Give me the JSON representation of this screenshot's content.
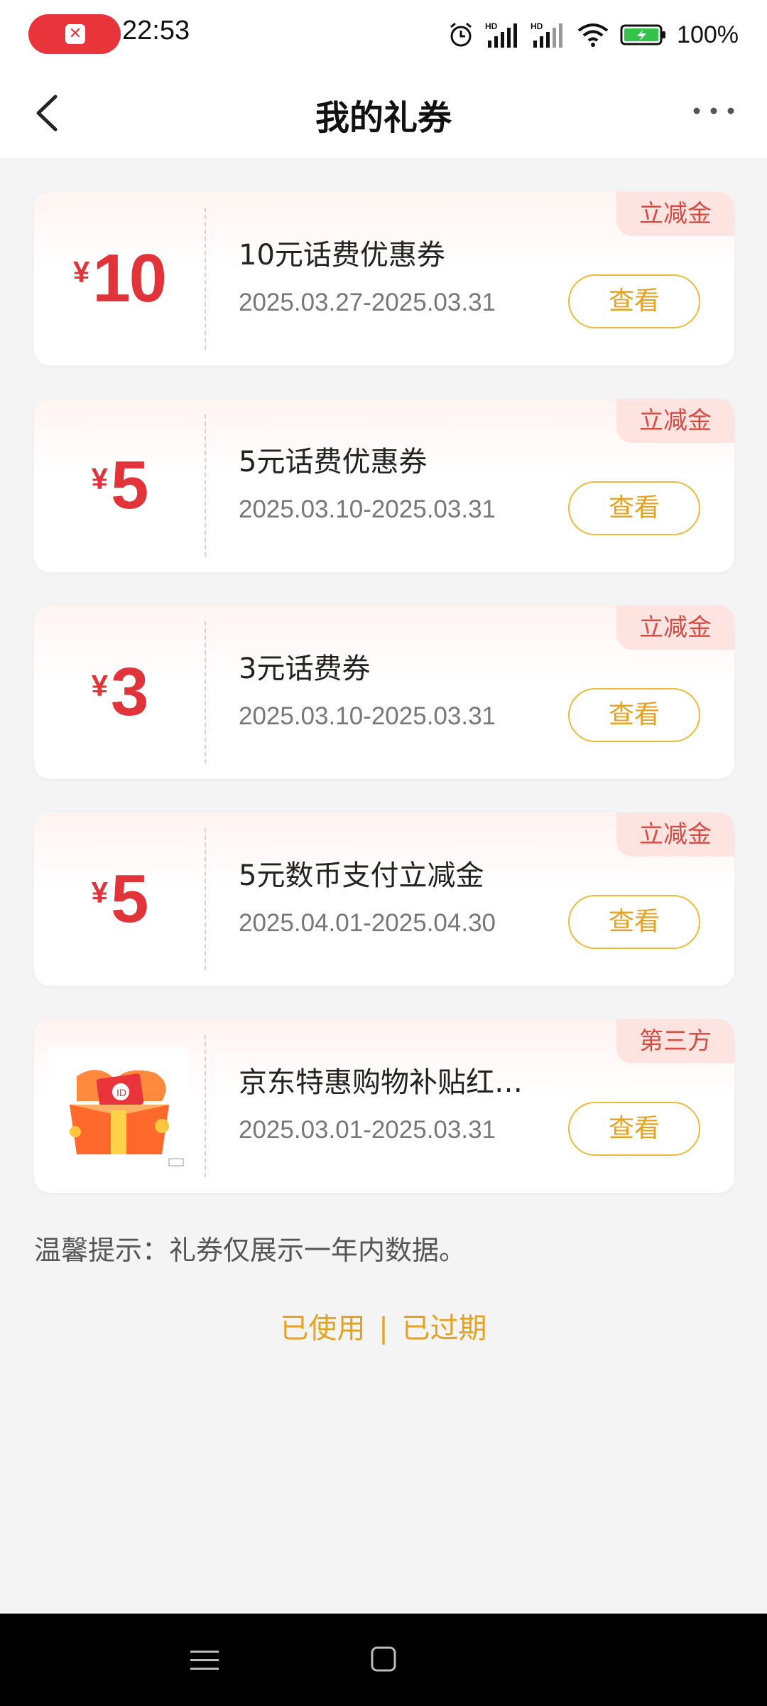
{
  "status_bar": {
    "time": "22:53",
    "battery": "100%",
    "icons": [
      "record-icon",
      "alarm-icon",
      "signal-hd-icon",
      "signal-hd-icon",
      "wifi-icon",
      "battery-charging-icon"
    ]
  },
  "header": {
    "title": "我的礼券"
  },
  "coupons": [
    {
      "yen": "¥",
      "amount": "10",
      "name": "10元话费优惠券",
      "date": "2025.03.27-2025.03.31",
      "button": "查看",
      "tag": "立减金"
    },
    {
      "yen": "¥",
      "amount": "5",
      "name": "5元话费优惠券",
      "date": "2025.03.10-2025.03.31",
      "button": "查看",
      "tag": "立减金"
    },
    {
      "yen": "¥",
      "amount": "3",
      "name": "3元话费券",
      "date": "2025.03.10-2025.03.31",
      "button": "查看",
      "tag": "立减金"
    },
    {
      "yen": "¥",
      "amount": "5",
      "name": "5元数币支付立减金",
      "date": "2025.04.01-2025.04.30",
      "button": "查看",
      "tag": "立减金"
    },
    {
      "name": "京东特惠购物补贴红…",
      "date": "2025.03.01-2025.03.31",
      "button": "查看",
      "tag": "第三方",
      "image": "gift-box-image"
    }
  ],
  "tip": "温馨提示：礼券仅展示一年内数据。",
  "links": {
    "used": "已使用",
    "separator": "|",
    "expired": "已过期"
  },
  "colors": {
    "accent_red": "#e0343a",
    "accent_gold": "#e6a21e",
    "tag_bg": "#fde4e0"
  }
}
